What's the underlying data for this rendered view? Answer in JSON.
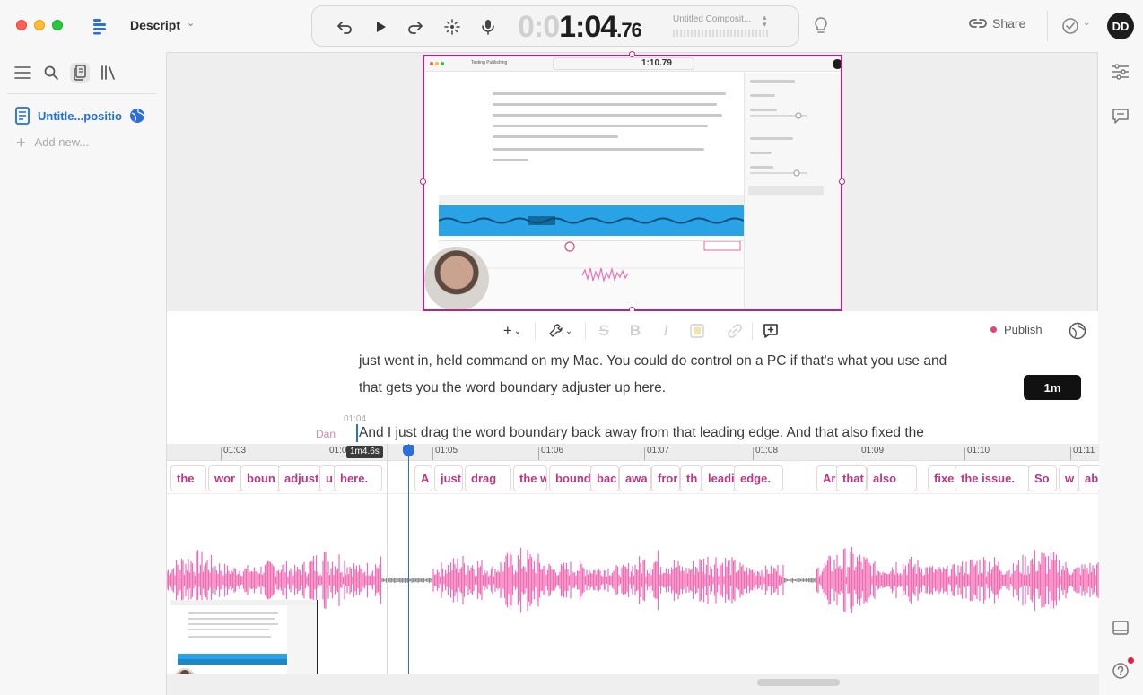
{
  "app": {
    "name": "Descript"
  },
  "transport": {
    "timecode_dim": "0:0",
    "timecode_main": "1:04",
    "timecode_frac": ".76",
    "composition": "Untitled Composit..."
  },
  "share": {
    "label": "Share"
  },
  "user": {
    "initials": "DD"
  },
  "sidebar": {
    "document": "Untitle...positio",
    "add_new": "Add new..."
  },
  "canvas": {
    "mini_timecode": "1:10.79",
    "mini_title": "Testing Publishing"
  },
  "script": {
    "publish_label": "Publish",
    "line1": "just went in, held command on my Mac. You could do control on a PC if that's what you use and",
    "line2": "that gets you the word boundary adjuster up here.",
    "badge": "1m",
    "speaker_time": "01:04",
    "speaker": "Dan",
    "line3": "And I just drag the word boundary back away from that leading edge. And that also fixed the"
  },
  "timeline": {
    "playhead_badge": "1m4.6s",
    "ticks": [
      "01:03",
      "01:0",
      "01:05",
      "01:06",
      "01:07",
      "01:08",
      "01:09",
      "01:10",
      "01:11"
    ],
    "words": [
      "the",
      "wor",
      "boun",
      "adjust",
      "u",
      "here.",
      "A",
      "just",
      "drag",
      "the w",
      "bound",
      "bac",
      "awa",
      "fror",
      "th",
      "leadi",
      "edge.",
      "Ar",
      "that",
      "also",
      "fixed",
      "the issue.",
      "So",
      "w",
      "able"
    ]
  },
  "colors": {
    "accent": "#b3287e",
    "word_text": "#c0367f",
    "waveform": "#f06cb4",
    "playhead": "#2a6fdb"
  }
}
